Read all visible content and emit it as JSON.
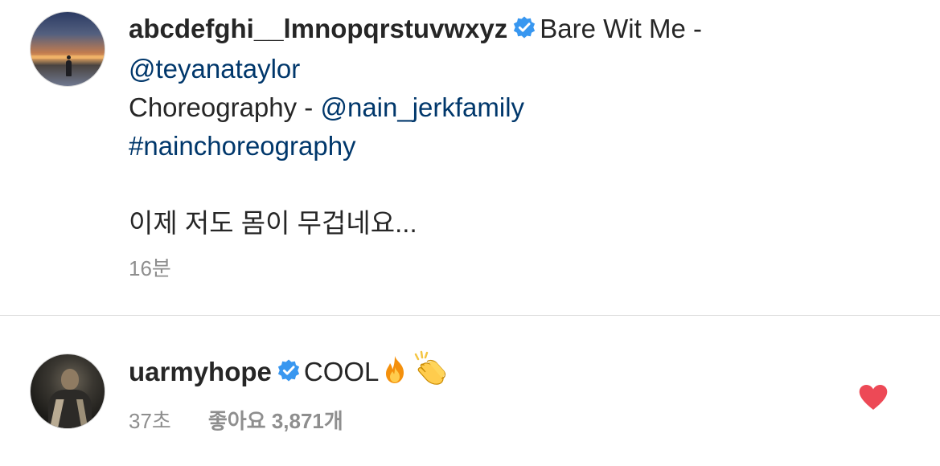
{
  "post": {
    "username": "abcdefghi__lmnopqrstuvwxyz",
    "caption_line1_text": "Bare Wit Me -",
    "caption_mention1": "@teyanataylor",
    "caption_line3_prefix": "Choreography - ",
    "caption_mention2": "@nain_jerkfamily",
    "caption_hashtag": "#nainchoreography",
    "caption_korean": "이제 저도 몸이 무겁네요...",
    "timestamp": "16분"
  },
  "comment": {
    "username": "uarmyhope",
    "text": "COOL",
    "emojis": [
      "fire-emoji",
      "clapping-hands-emoji"
    ],
    "timestamp": "37초",
    "likes_label": "좋아요 3,871개"
  },
  "colors": {
    "link": "#00376b",
    "verified": "#3897f0",
    "heart": "#ed4956",
    "meta": "#8e8e8e"
  },
  "icons": {
    "verified_badge": "verified-badge-icon",
    "like": "heart-icon"
  }
}
